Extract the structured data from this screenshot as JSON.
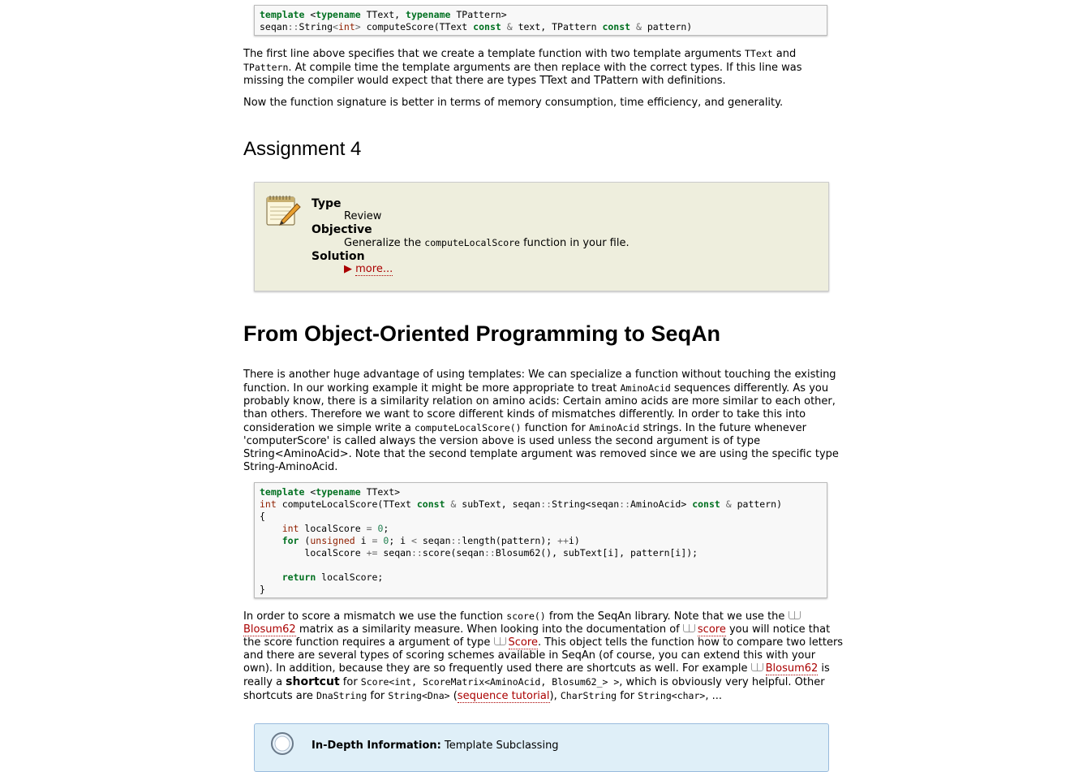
{
  "code1": {
    "line1": {
      "kw1": "template",
      "p1": " <",
      "kw2": "typename",
      "p2": " TText, ",
      "kw3": "typename",
      "p3": " TPattern>"
    },
    "line2": {
      "p1": "seqan",
      "op1": "::",
      "p2": "String",
      "op2": "<",
      "t1": "int",
      "op3": ">",
      "p3": " computeScore(TText ",
      "kw1": "const",
      "op4": " & ",
      "p4": "text, TPattern ",
      "kw2": "const",
      "op5": " & ",
      "p5": "pattern)"
    }
  },
  "para1": {
    "a": "The first line above specifies that we create a template function with two template arguments ",
    "c1": "TText",
    "b": " and ",
    "c2": "TPattern",
    "c": ". At compile time the template arguments are then replace with the correct types. If this line was missing the compiler would expect that there are types TText and TPattern with definitions."
  },
  "para2": "Now the function signature is better in terms of memory consumption, time efficiency, and generality.",
  "assignment_heading": "Assignment 4",
  "assignment": {
    "icon": "notepad-pencil-icon",
    "type_label": "Type",
    "type_value": "Review",
    "objective_label": "Objective",
    "objective_a": "Generalize the ",
    "objective_code": "computeLocalScore",
    "objective_b": " function in your file.",
    "solution_label": "Solution",
    "more_label": "more..."
  },
  "section_heading": "From Object-Oriented Programming to SeqAn",
  "para3": {
    "a": "There is another huge advantage of using templates: We can specialize a function without touching the existing function. In our working example it might be more appropriate to treat ",
    "c1": "AminoAcid",
    "b": " sequences differently. As you probably know, there is a similarity relation on amino acids: Certain amino acids are more similar to each other, than others. Therefore we want to score different kinds of mismatches differently. In order to take this into consideration we simple write a ",
    "c2": "computeLocalScore()",
    "c": " function for ",
    "c3": "AminoAcid",
    "d": " strings. In the future whenever 'computerScore' is called always the version above is used unless the second argument is of type String<AminoAcid>. Note that the second template argument was removed since we are using the specific type String-AminoAcid."
  },
  "code2": {
    "l1": {
      "kw1": "template",
      "p1": " <",
      "kw2": "typename",
      "p2": " TText>"
    },
    "l2": {
      "t1": "int",
      "p1": " computeLocalScore(TText ",
      "kw1": "const",
      "op1": " & ",
      "p2": "subText, seqan",
      "op2": "::",
      "p3": "String<seqan",
      "op3": "::",
      "p4": "AminoAcid> ",
      "kw2": "const",
      "op4": " & ",
      "p5": "pattern)"
    },
    "l3": "{",
    "l4": {
      "ind": "    ",
      "t1": "int",
      "p1": " localScore ",
      "op1": "=",
      "n1": " 0",
      "p2": ";"
    },
    "l5": {
      "ind": "    ",
      "kw1": "for",
      "p1": " (",
      "t1": "unsigned",
      "p2": " i ",
      "op1": "=",
      "n1": " 0",
      "p3": "; i ",
      "op2": "<",
      "p4": " seqan",
      "op3": "::",
      "p5": "length(pattern); ",
      "op4": "++",
      "p6": "i)"
    },
    "l6": {
      "ind": "        ",
      "p1": "localScore ",
      "op1": "+=",
      "p2": " seqan",
      "op2": "::",
      "p3": "score(seqan",
      "op3": "::",
      "p4": "Blosum62(), subText[i], pattern[i]);"
    },
    "l7": "",
    "l8": {
      "ind": "    ",
      "kw1": "return",
      "p1": " localScore;"
    },
    "l9": "}"
  },
  "para4": {
    "a": "In order to score a mismatch we use the function ",
    "c1": "score()",
    "b": " from the SeqAn library. Note that we use the ",
    "l1": "Blosum62",
    "c": " matrix as a similarity measure. When looking into the documentation of ",
    "l2": "score",
    "d": " you will notice that the score function requires a argument of type ",
    "l3": "Score",
    "e": ". This object tells the function how to compare two letters and there are several types of scoring schemes available in SeqAn (of course, you can extend this with your own). In addition, because they are so frequently used there are shortcuts as well. For example ",
    "l4": "Blosum62",
    "f": " is really a ",
    "strong": "shortcut",
    "g": " for ",
    "c2": "Score<int, ScoreMatrix<AminoAcid, Blosum62_> >",
    "h": ", which is obviously very helpful. Other shortcuts are ",
    "c3": "DnaString",
    "i": " for ",
    "c4": "String<Dna>",
    "j": " (",
    "l5": "sequence tutorial",
    "k": "), ",
    "c5": "CharString",
    "m": " for ",
    "c6": "String<char>",
    "n": ", ..."
  },
  "infobox": {
    "icon": "magnifier-icon",
    "label": "In-Depth Information:",
    "text": " Template Subclassing"
  },
  "colors": {
    "keyword": "#007020",
    "type": "#902000",
    "link": "#aa0000",
    "assignment_bg": "#eeeedd",
    "info_bg": "#dfeff8"
  }
}
